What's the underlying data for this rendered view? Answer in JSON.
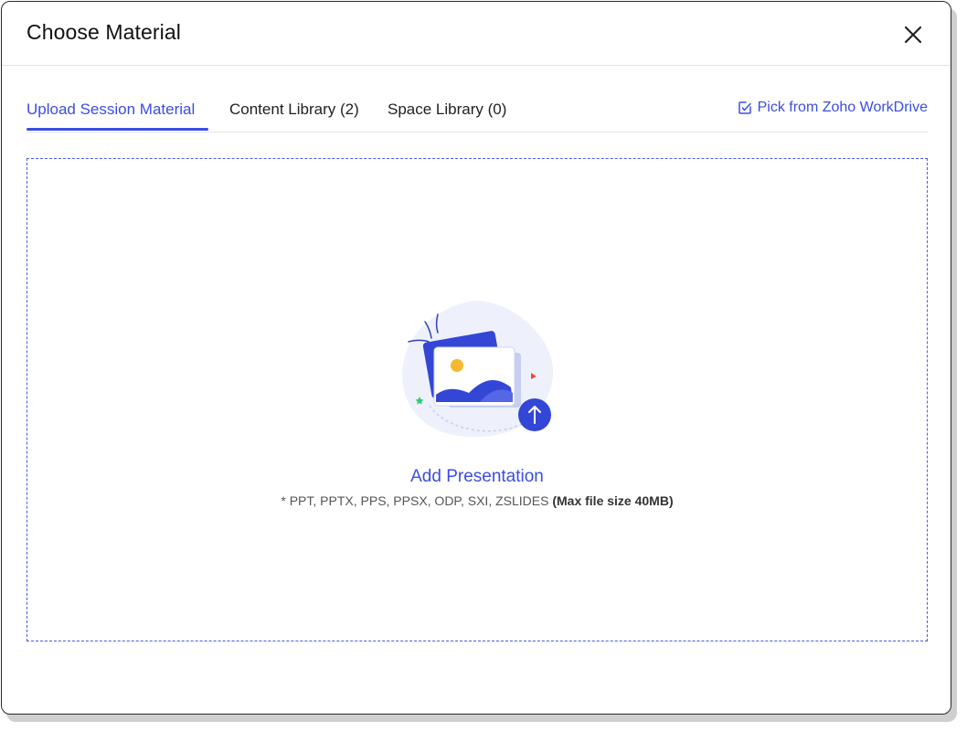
{
  "dialog": {
    "title": "Choose Material",
    "close_icon": "close-icon"
  },
  "tabs": [
    {
      "label": "Upload Session Material",
      "active": true
    },
    {
      "label": "Content Library (2)",
      "active": false
    },
    {
      "label": "Space Library (0)",
      "active": false
    }
  ],
  "workdrive": {
    "label": "Pick from Zoho WorkDrive",
    "icon": "external-pick-icon"
  },
  "dropzone": {
    "illustration_icon": "image-upload-icon",
    "add_label": "Add Presentation",
    "formats_text": "* PPT, PPTX, PPS, PPSX, ODP, SXI, ZSLIDES",
    "max_size_text": "(Max file size 40MB)"
  },
  "colors": {
    "accent": "#3b4de0",
    "text": "#1f1f1f",
    "border": "#e3e3e3"
  }
}
